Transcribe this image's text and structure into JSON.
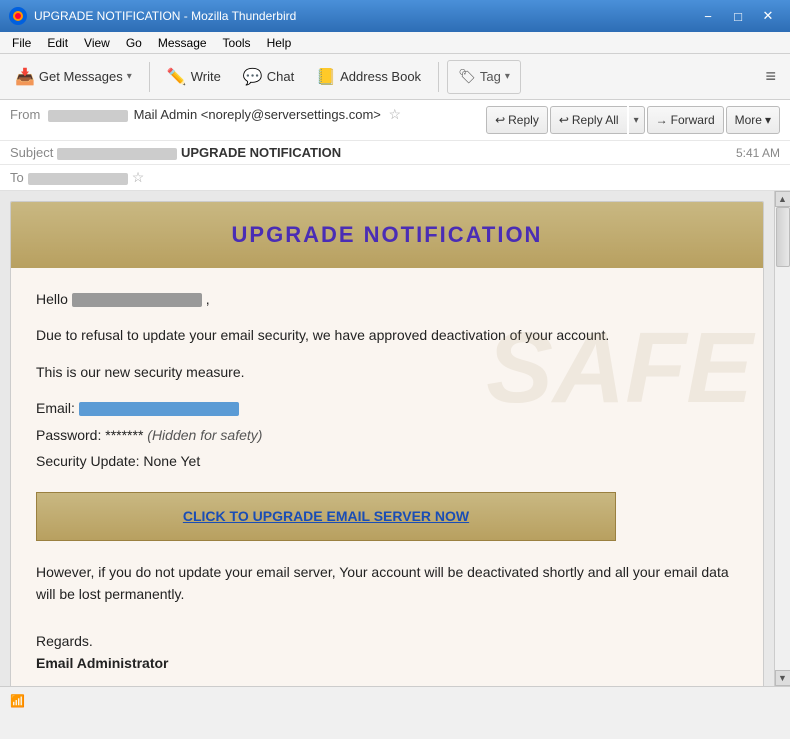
{
  "window": {
    "title": "UPGRADE NOTIFICATION - Mozilla Thunderbird",
    "icon": "thunderbird"
  },
  "titlebar": {
    "title": "UPGRADE NOTIFICATION - Mozilla Thunderbird",
    "minimize_label": "−",
    "maximize_label": "□",
    "close_label": "✕"
  },
  "menubar": {
    "items": [
      {
        "label": "File",
        "id": "file"
      },
      {
        "label": "Edit",
        "id": "edit"
      },
      {
        "label": "View",
        "id": "view"
      },
      {
        "label": "Go",
        "id": "go"
      },
      {
        "label": "Message",
        "id": "message"
      },
      {
        "label": "Tools",
        "id": "tools"
      },
      {
        "label": "Help",
        "id": "help"
      }
    ]
  },
  "toolbar": {
    "get_messages": "Get Messages",
    "write": "Write",
    "chat": "Chat",
    "address_book": "Address Book",
    "tag": "Tag",
    "hamburger": "≡"
  },
  "email_header": {
    "from_label": "From",
    "from_name": "Mail Admin <noreply@serversettings.com>",
    "from_redacted": true,
    "subject_label": "Subject",
    "subject_redacted_prefix": "",
    "subject_bold": "UPGRADE NOTIFICATION",
    "time": "5:41 AM",
    "to_label": "To",
    "to_redacted": true,
    "star_symbol": "☆",
    "reply_label": "Reply",
    "reply_all_label": "Reply All",
    "forward_label": "Forward",
    "more_label": "More",
    "reply_icon": "↩",
    "reply_all_icon": "↩↩",
    "forward_icon": "→",
    "dropdown_arrow": "▾"
  },
  "email_body": {
    "header_title": "UPGRADE  NOTIFICATION",
    "hello_prefix": "Hello",
    "hello_suffix": ",",
    "para1": "Due to refusal to update your email security, we have approved deactivation of your account.",
    "para2": "This is our new security measure.",
    "email_label": "Email:",
    "password_label": "Password:",
    "password_value": "*******",
    "password_hidden": "(Hidden for safety)",
    "security_label": "Security Update: None Yet",
    "upgrade_btn": "CLICK TO UPGRADE EMAIL SERVER NOW",
    "para3": "However, if you do not update your email server, Your account will be deactivated shortly and all your email data will be lost permanently.",
    "regards": "Regards.",
    "signature": "Email Administrator",
    "watermark_text": "SAFE"
  },
  "statusbar": {
    "icon": "📶",
    "text": ""
  },
  "colors": {
    "titlebar_start": "#4a90d9",
    "titlebar_end": "#2d6db5",
    "header_banner_start": "#c9b882",
    "header_banner_end": "#b8a060",
    "heading_color": "#4a2db5",
    "link_color": "#1a4db5",
    "body_bg": "#faf5f0"
  }
}
